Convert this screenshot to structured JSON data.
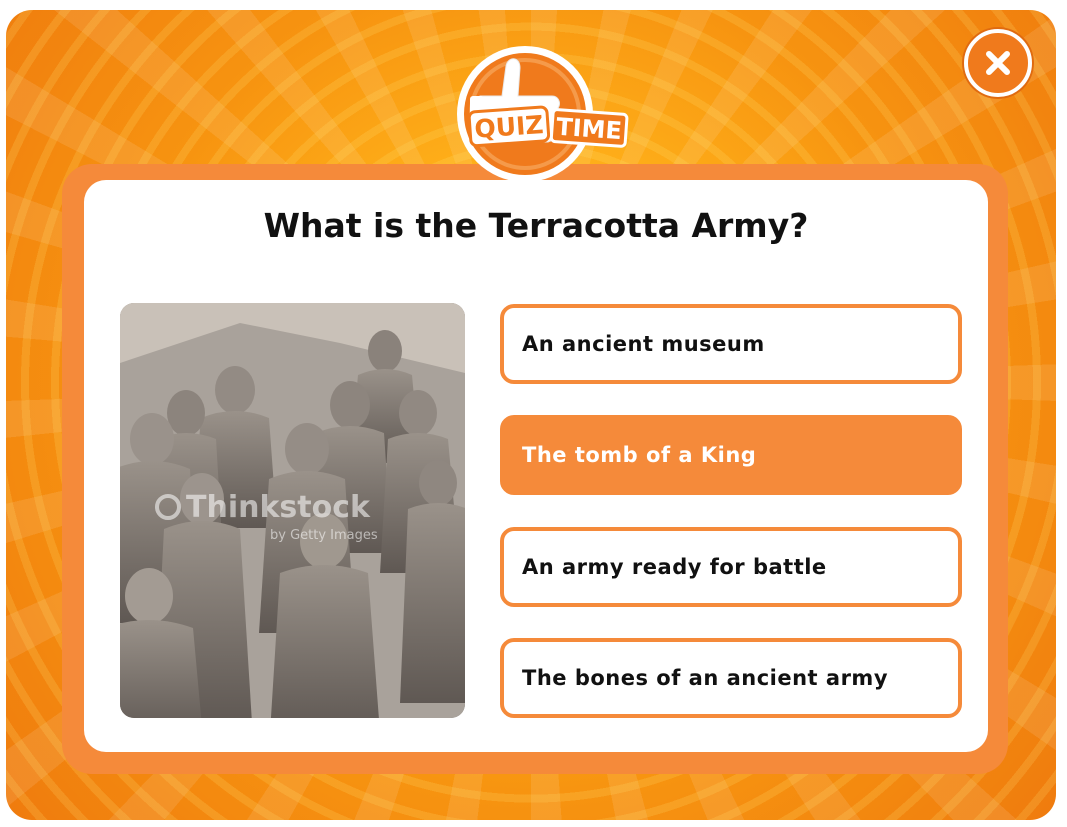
{
  "quiz": {
    "badge_word1": "QUIZ",
    "badge_word2": "TIME",
    "question": "What is the Terracotta Army?",
    "image": {
      "watermark_main": "Thinkstock",
      "watermark_sub": "by Getty Images"
    },
    "answers": [
      {
        "label": "An ancient museum",
        "selected": false
      },
      {
        "label": "The tomb of a King",
        "selected": true
      },
      {
        "label": "An army ready for battle",
        "selected": false
      },
      {
        "label": "The bones of an ancient army",
        "selected": false
      }
    ]
  },
  "icons": {
    "close": "close-icon",
    "badge": "thumbs-up-icon"
  },
  "colors": {
    "accent": "#f58a3a",
    "background_light": "#ffc21f",
    "background_dark": "#ef7b0e",
    "text": "#111111",
    "selected_text": "#ffffff"
  }
}
